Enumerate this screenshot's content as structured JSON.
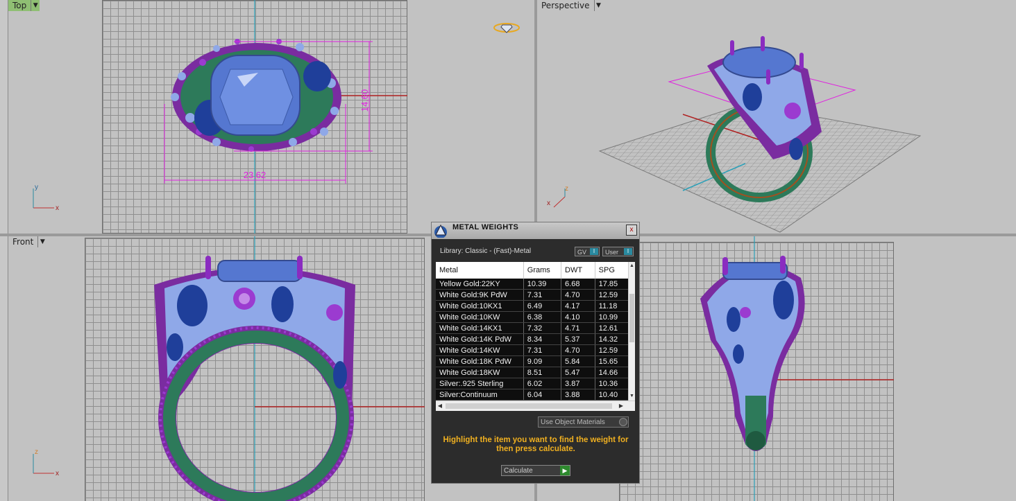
{
  "viewports": {
    "top": {
      "label": "Top",
      "dim_width": "23.62",
      "dim_height": "14.60",
      "axis_a": "y",
      "axis_b": "x"
    },
    "perspective": {
      "label": "Perspective",
      "axis_a": "z",
      "axis_b": "x"
    },
    "front": {
      "label": "Front",
      "axis_a": "z",
      "axis_b": "x"
    }
  },
  "dialog": {
    "title": "METAL WEIGHTS",
    "close_label": "x",
    "library": "Library: Classic - (Fast)-Metal",
    "gv_label": "GV",
    "user_label": "User",
    "columns": [
      "Metal",
      "Grams",
      "DWT",
      "SPG"
    ],
    "rows": [
      {
        "metal": "Yellow Gold:22KY",
        "grams": "10.39",
        "dwt": "6.68",
        "spg": "17.85"
      },
      {
        "metal": "White Gold:9K PdW",
        "grams": "7.31",
        "dwt": "4.70",
        "spg": "12.59"
      },
      {
        "metal": "White Gold:10KX1",
        "grams": "6.49",
        "dwt": "4.17",
        "spg": "11.18"
      },
      {
        "metal": "White Gold:10KW",
        "grams": "6.38",
        "dwt": "4.10",
        "spg": "10.99"
      },
      {
        "metal": "White Gold:14KX1",
        "grams": "7.32",
        "dwt": "4.71",
        "spg": "12.61"
      },
      {
        "metal": "White Gold:14K PdW",
        "grams": "8.34",
        "dwt": "5.37",
        "spg": "14.32"
      },
      {
        "metal": "White Gold:14KW",
        "grams": "7.31",
        "dwt": "4.70",
        "spg": "12.59"
      },
      {
        "metal": "White Gold:18K PdW",
        "grams": "9.09",
        "dwt": "5.84",
        "spg": "15.65"
      },
      {
        "metal": "White Gold:18KW",
        "grams": "8.51",
        "dwt": "5.47",
        "spg": "14.66"
      },
      {
        "metal": "Silver:.925 Sterling",
        "grams": "6.02",
        "dwt": "3.87",
        "spg": "10.36"
      },
      {
        "metal": "Silver:Continuum",
        "grams": "6.04",
        "dwt": "3.88",
        "spg": "10.40"
      }
    ],
    "use_object_materials": "Use Object Materials",
    "hint": "Highlight the item you want to find the weight for then press calculate.",
    "calculate_label": "Calculate"
  }
}
